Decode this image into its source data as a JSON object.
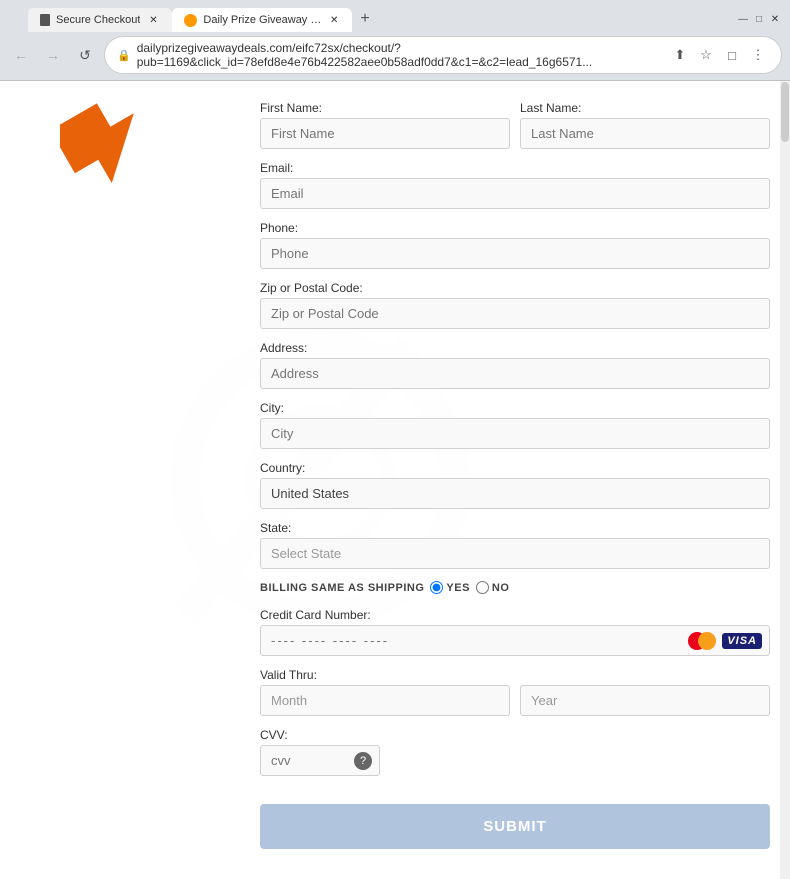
{
  "browser": {
    "tabs": [
      {
        "id": "tab1",
        "label": "Secure Checkout",
        "active": false,
        "favicon_color": "#4CAF50"
      },
      {
        "id": "tab2",
        "label": "Daily Prize Giveaway Deals",
        "active": true,
        "favicon_color": "#ff9900"
      }
    ],
    "new_tab_label": "+",
    "address": "dailyprizegiveawaydeals.com/eifc72sx/checkout/?pub=1169&click_id=78efd8e4e76b422582aee0b58adf0dd7&c1=&c2=lead_16g6571...",
    "nav": {
      "back": "←",
      "forward": "→",
      "reload": "↺"
    },
    "toolbar_icons": [
      "⭐",
      "⋮"
    ]
  },
  "form": {
    "title": "Secure Checkout",
    "fields": {
      "first_name_label": "First Name:",
      "first_name_placeholder": "First Name",
      "last_name_label": "Last Name:",
      "last_name_placeholder": "Last Name",
      "email_label": "Email:",
      "email_placeholder": "Email",
      "phone_label": "Phone:",
      "phone_placeholder": "Phone",
      "zip_label": "Zip or Postal Code:",
      "zip_placeholder": "Zip or Postal Code",
      "address_label": "Address:",
      "address_placeholder": "Address",
      "city_label": "City:",
      "city_placeholder": "City",
      "country_label": "Country:",
      "country_value": "United States",
      "state_label": "State:",
      "state_placeholder": "Select State",
      "billing_label": "BILLING SAME AS SHIPPING",
      "billing_yes": "YES",
      "billing_no": "NO",
      "cc_label": "Credit Card Number:",
      "cc_placeholder": "---- ---- ---- ----",
      "valid_thru_label": "Valid Thru:",
      "month_placeholder": "Month",
      "year_placeholder": "Year",
      "cvv_label": "CVV:",
      "cvv_placeholder": "cvv",
      "submit_label": "SUBMIT"
    }
  }
}
